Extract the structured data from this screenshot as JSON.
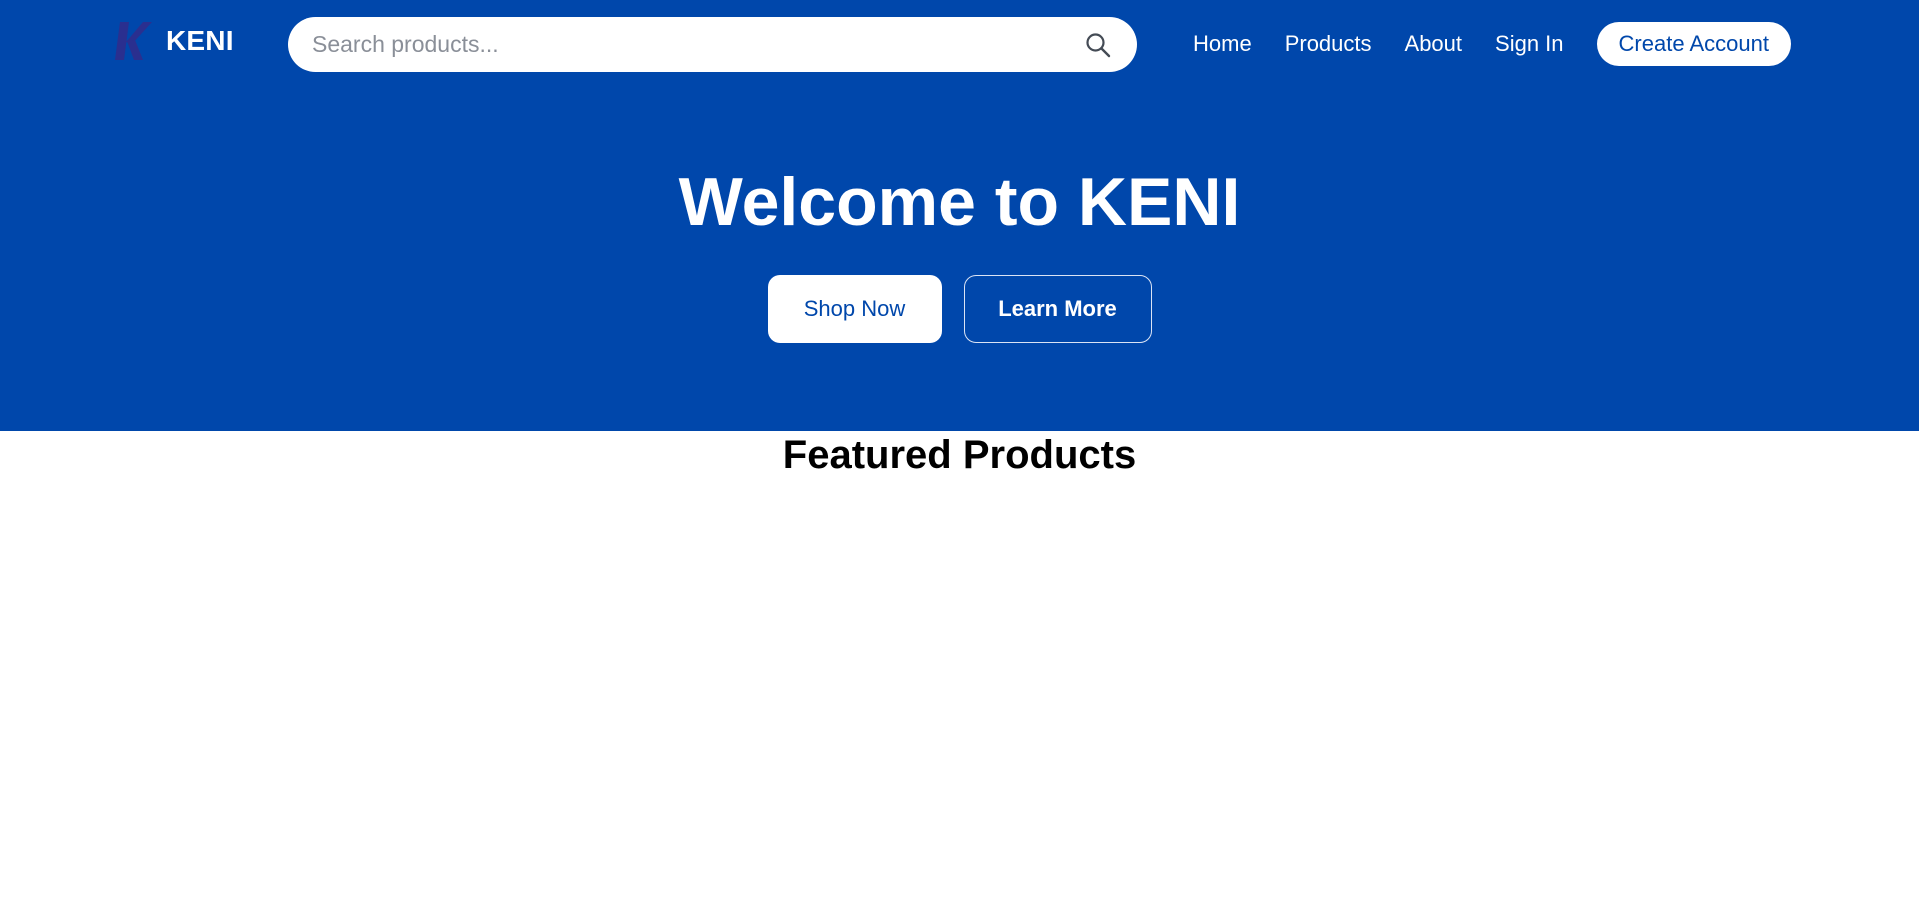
{
  "brand": {
    "name": "KENI",
    "logo_letter": "K",
    "logo_icon": "k-logo-icon",
    "primary_color": "#0047ab"
  },
  "search": {
    "placeholder": "Search products...",
    "value": "",
    "icon": "search-icon"
  },
  "nav": {
    "items": [
      {
        "label": "Home"
      },
      {
        "label": "Products"
      },
      {
        "label": "About"
      },
      {
        "label": "Sign In"
      }
    ],
    "create_account_label": "Create Account"
  },
  "hero": {
    "title": "Welcome to KENI",
    "shop_now_label": "Shop Now",
    "learn_more_label": "Learn More"
  },
  "featured": {
    "title": "Featured Products"
  }
}
